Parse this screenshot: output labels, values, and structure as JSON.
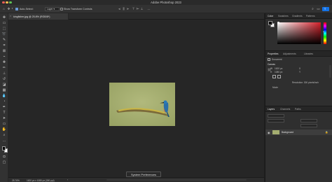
{
  "app": {
    "title": "Adobe Photoshop 2023"
  },
  "options_bar": {
    "auto_select_label": "Auto-Select:",
    "auto_select_checked": true,
    "layer_dropdown": "Layer",
    "show_transform_label": "Show Transform Controls",
    "show_transform_checked": false
  },
  "document": {
    "tab_label": "kingfisher.jpg @ 25.8% (RGB/8*)"
  },
  "status_bar": {
    "zoom": "25.76%",
    "doc_size": "1620 px x 1080 px (300 ppi)"
  },
  "tooltip": {
    "text": "System Preferences"
  },
  "color_panel": {
    "tabs": [
      "Color",
      "Swatches",
      "Gradients",
      "Patterns"
    ],
    "active_tab": "Color",
    "hue_color": "#d4202a"
  },
  "properties_panel": {
    "tabs": [
      "Properties",
      "Adjustments",
      "Libraries"
    ],
    "active_tab": "Properties",
    "document_label": "Document",
    "canvas_heading": "Canvas",
    "width_label": "W",
    "width_value": "1620 px",
    "height_label": "H",
    "height_value": "1080 px",
    "x_label": "X",
    "y_label": "Y",
    "resolution_label": "Resolution: 300 pixels/inch",
    "mode_label": "Mode"
  },
  "layers_panel": {
    "tabs": [
      "Layers",
      "Channels",
      "Paths"
    ],
    "active_tab": "Layers",
    "layers": [
      {
        "name": "Background",
        "visible": true,
        "locked": true
      }
    ]
  },
  "colors": {
    "foreground": "#000000",
    "background": "#ffffff",
    "photo_bg": "#a4ad70"
  }
}
